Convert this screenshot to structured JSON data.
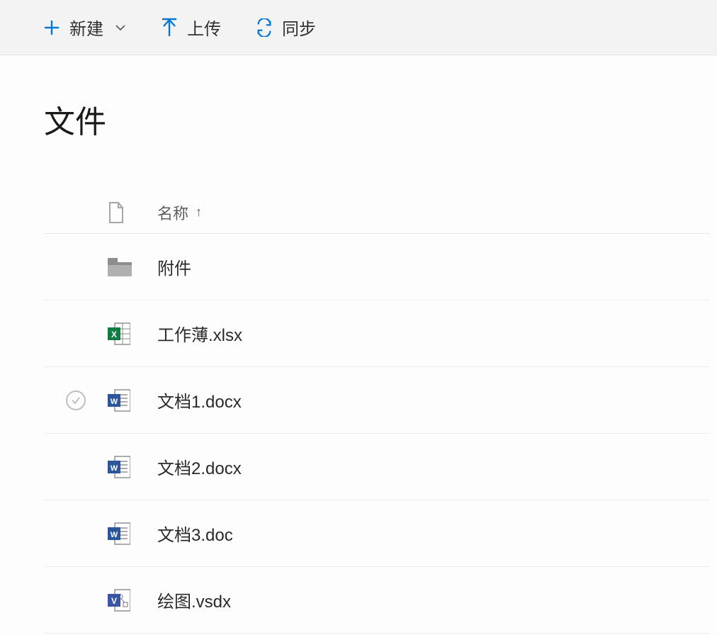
{
  "toolbar": {
    "new_label": "新建",
    "upload_label": "上传",
    "sync_label": "同步"
  },
  "page": {
    "title": "文件"
  },
  "columns": {
    "name_header": "名称"
  },
  "files": [
    {
      "name": "附件",
      "type": "folder",
      "selected": false
    },
    {
      "name": "工作薄.xlsx",
      "type": "xlsx",
      "selected": false
    },
    {
      "name": "文档1.docx",
      "type": "docx",
      "selected": true
    },
    {
      "name": "文档2.docx",
      "type": "docx",
      "selected": false
    },
    {
      "name": "文档3.doc",
      "type": "docx",
      "selected": false
    },
    {
      "name": "绘图.vsdx",
      "type": "vsdx",
      "selected": false
    }
  ]
}
